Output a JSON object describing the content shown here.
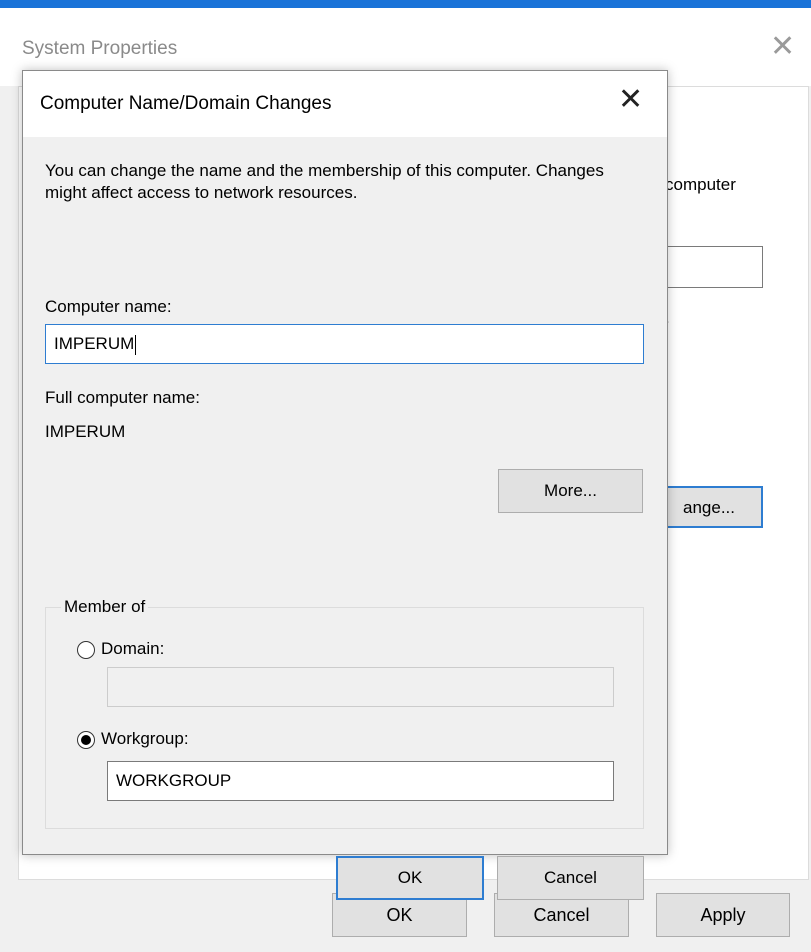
{
  "system_properties": {
    "title": "System Properties",
    "close_icon": "✕",
    "panel_text_fragment": "computer",
    "panel_dot": ".",
    "change_button_fragment": "ange...",
    "buttons": {
      "ok": "OK",
      "cancel": "Cancel",
      "apply": "Apply"
    }
  },
  "dialog": {
    "title": "Computer Name/Domain Changes",
    "close_icon": "✕",
    "description": "You can change the name and the membership of this computer. Changes might affect access to network resources.",
    "computer_name_label": "Computer name:",
    "computer_name_value": "IMPERUM",
    "full_name_label": "Full computer name:",
    "full_name_value": "IMPERUM",
    "more_button": "More...",
    "member_of": {
      "legend": "Member of",
      "domain_label": "Domain:",
      "domain_value": "",
      "domain_selected": false,
      "workgroup_label": "Workgroup:",
      "workgroup_value": "WORKGROUP",
      "workgroup_selected": true
    },
    "ok_button": "OK",
    "cancel_button": "Cancel"
  },
  "colors": {
    "accent": "#1a73d8",
    "focus": "#2e7dd1"
  }
}
